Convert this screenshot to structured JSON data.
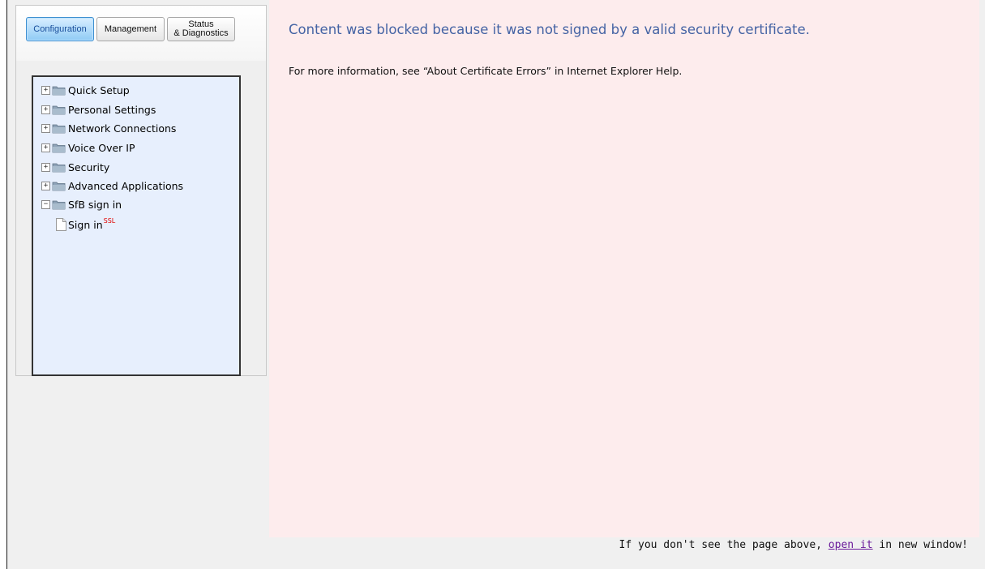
{
  "tabs": {
    "configuration": "Configuration",
    "management": "Management",
    "status": "Status\n& Diagnostics"
  },
  "tree": {
    "items": [
      {
        "label": "Quick Setup",
        "expander": "+"
      },
      {
        "label": "Personal Settings",
        "expander": "+"
      },
      {
        "label": "Network Connections",
        "expander": "+"
      },
      {
        "label": "Voice Over IP",
        "expander": "+"
      },
      {
        "label": "Security",
        "expander": "+"
      },
      {
        "label": "Advanced Applications",
        "expander": "+"
      },
      {
        "label": "SfB sign in",
        "expander": "−"
      }
    ],
    "child": {
      "label": "Sign in",
      "badge": "SSL"
    }
  },
  "content": {
    "title": "Content was blocked because it was not signed by a valid security certificate.",
    "info": "For more information, see “About Certificate Errors” in Internet Explorer Help."
  },
  "footer": {
    "before": "If you don't see the page above, ",
    "link": "open it",
    "after": " in new window!"
  },
  "colors": {
    "content_bg": "#fdeced",
    "title": "#4463a4",
    "tree_bg": "#e7effd",
    "active_tab": "#8fcbf5",
    "ssl_badge": "#e00000",
    "link": "#6a1b9a"
  },
  "icons": {
    "tree_item": "folder-icon",
    "tree_child": "page-icon",
    "expander": "plus-minus-box"
  }
}
